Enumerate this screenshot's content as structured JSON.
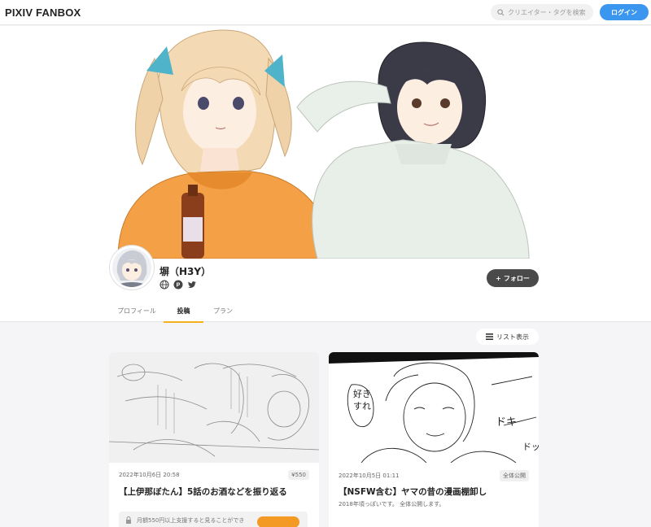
{
  "header": {
    "logo": "PIXIV FANBOX",
    "search_placeholder": "クリエイター・タグを検索",
    "login_label": "ログイン"
  },
  "creator": {
    "name": "塀（H3Y）",
    "follow_label": "フォロー",
    "social": [
      "globe-icon",
      "pixiv-icon",
      "twitter-icon"
    ]
  },
  "tabs": [
    {
      "label": "プロフィール"
    },
    {
      "label": "投稿",
      "active": true
    },
    {
      "label": "プラン"
    }
  ],
  "list_view_label": "リスト表示",
  "posts": [
    {
      "date": "2022年10月6日 20:58",
      "badge": "¥550",
      "title": "【上伊那ぼたん】5話のお酒などを振り返る",
      "lock_text": "月額550円以上支援すると見ることができ"
    },
    {
      "date": "2022年10月5日 01:11",
      "badge": "全体公開",
      "title": "【NSFW含む】ヤマの昔の漫画棚卸し",
      "desc": "2018年頃っぽいです。 全体公開します。"
    }
  ],
  "colors": {
    "accent": "#3b96f0",
    "tab_underline": "#f5b01f",
    "follow_bg": "#4a4a4a"
  }
}
